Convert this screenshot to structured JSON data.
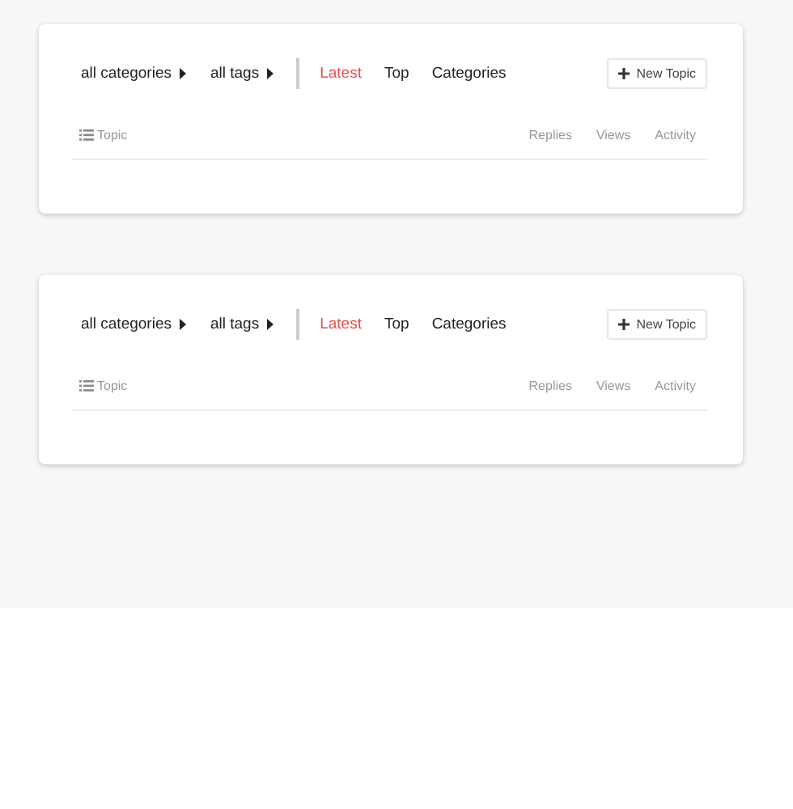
{
  "panels": [
    {
      "filters": [
        {
          "label": "all categories"
        },
        {
          "label": "all tags"
        }
      ],
      "nav": [
        {
          "label": "Latest",
          "selected": true
        },
        {
          "label": "Top",
          "selected": false
        },
        {
          "label": "Categories",
          "selected": false
        }
      ],
      "new_topic_button": "New Topic",
      "columns": [
        "Topic",
        "Replies",
        "Views",
        "Activity"
      ]
    },
    {
      "filters": [
        {
          "label": "all categories"
        },
        {
          "label": "all tags"
        }
      ],
      "nav": [
        {
          "label": "Latest",
          "selected": true
        },
        {
          "label": "Top",
          "selected": false
        },
        {
          "label": "Categories",
          "selected": false
        }
      ],
      "new_topic_button": "New Topic",
      "columns": [
        "Topic",
        "Replies",
        "Views",
        "Activity"
      ]
    }
  ]
}
